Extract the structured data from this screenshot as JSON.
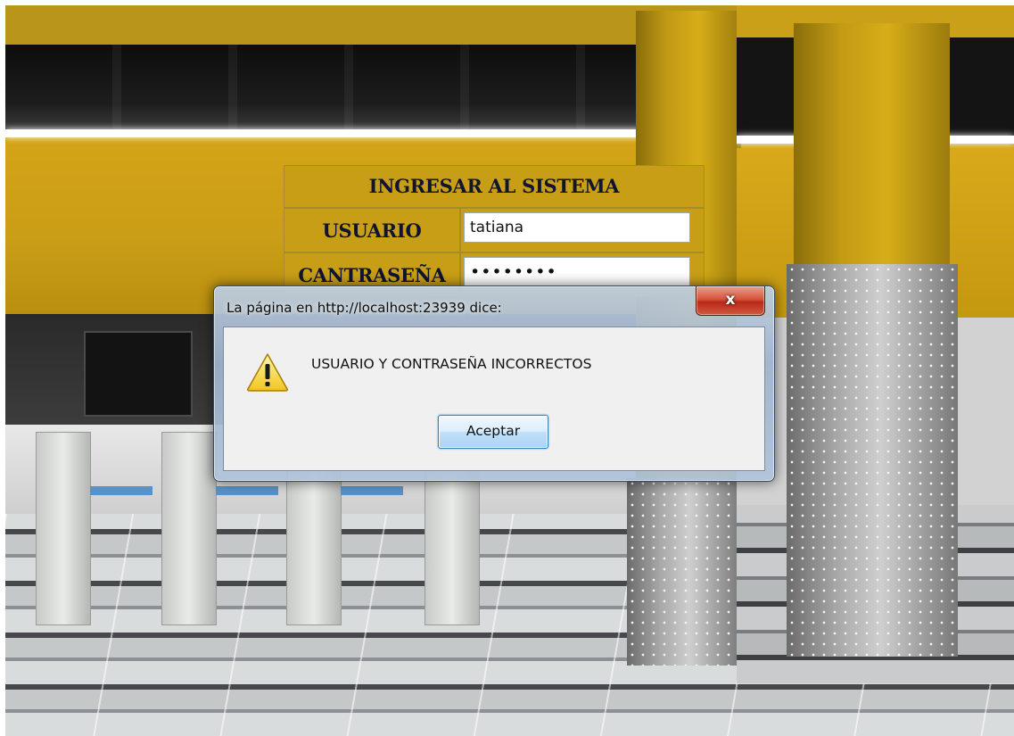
{
  "login_form": {
    "title": "INGRESAR AL SISTEMA",
    "username_label": "USUARIO",
    "username_value": "tatiana",
    "password_label": "CANTRASEÑA",
    "password_value": "tatiana1"
  },
  "alert": {
    "title": "La página en http://localhost:23939 dice:",
    "close_glyph": "x",
    "icon": "warning-icon",
    "message": "USUARIO Y CONTRASEÑA INCORRECTOS",
    "ok_label": "Aceptar"
  },
  "colors": {
    "form_background": "#c89e17",
    "form_text": "#0f1430",
    "close_button": "#c8321f",
    "ok_button_border": "#3c7fb1"
  }
}
